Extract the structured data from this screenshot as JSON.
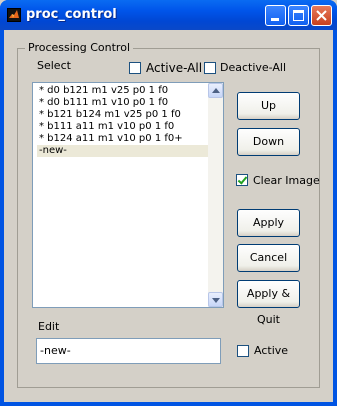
{
  "window": {
    "title": "proc_control"
  },
  "group": {
    "title": "Processing Control"
  },
  "labels": {
    "select": "Select",
    "edit": "Edit"
  },
  "checkboxes": {
    "active_all": {
      "label": "Active-All",
      "checked": false
    },
    "deactive_all": {
      "label": "Deactive-All",
      "checked": false
    },
    "clear_image": {
      "label": "Clear Image",
      "checked": true
    },
    "active": {
      "label": "Active",
      "checked": false
    }
  },
  "list": {
    "items": [
      "* d0 b121 m1 v25 p0 1 f0",
      "* d0 b111 m1 v10 p0 1 f0",
      "* b121 b124 m1 v25 p0 1 f0",
      "* b111 a11 m1 v10 p0 1 f0",
      "* b124 a11 m1 v10 p0 1 f0+",
      "-new-"
    ],
    "selected_index": 5
  },
  "buttons": {
    "up": "Up",
    "down": "Down",
    "apply": "Apply",
    "cancel": "Cancel",
    "apply_quit": "Apply & Quit"
  },
  "edit_field": {
    "value": "-new-"
  },
  "icons": [
    "matlab-icon",
    "minimize-icon",
    "maximize-icon",
    "close-icon",
    "scroll-up-icon",
    "scroll-down-icon"
  ],
  "colors": {
    "titlebar": "#0054e3",
    "close": "#c8401e",
    "face": "#d4d0c8",
    "check": "#21a121"
  }
}
